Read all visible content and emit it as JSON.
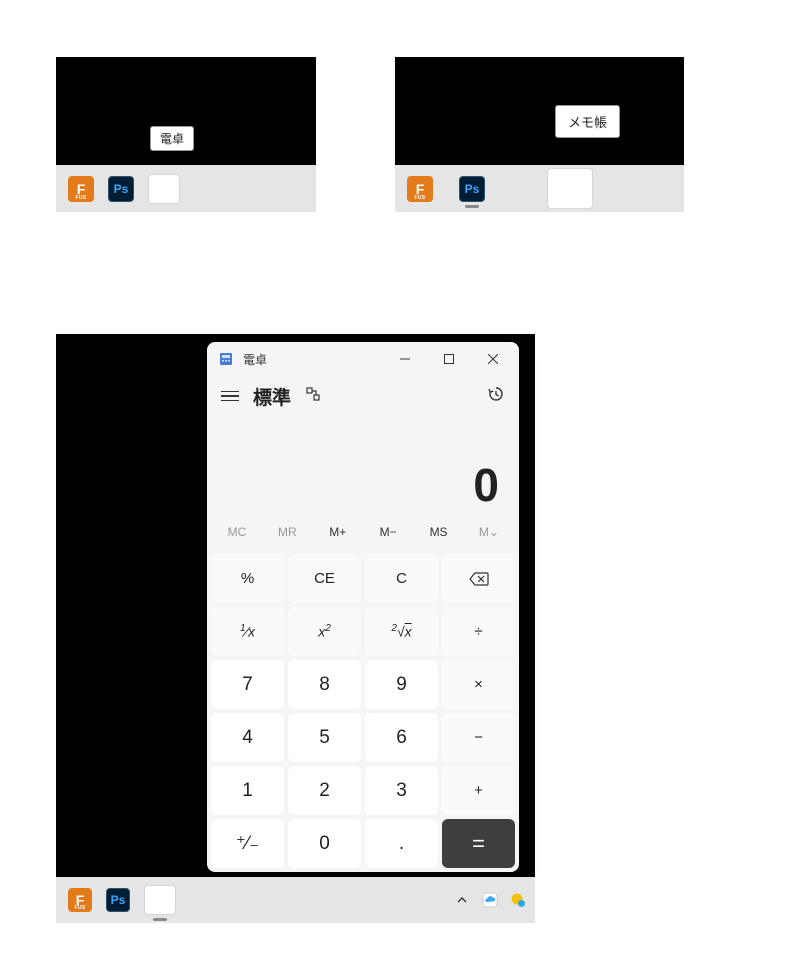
{
  "thumb1": {
    "tooltip": "電卓",
    "taskbar": {
      "fusion_label": "F",
      "fusion_sub": "FUS",
      "ps_label": "Ps"
    }
  },
  "thumb2": {
    "tooltip": "メモ帳",
    "taskbar": {
      "fusion_label": "F",
      "fusion_sub": "FUS",
      "ps_label": "Ps"
    }
  },
  "panel3": {
    "taskbar": {
      "fusion_label": "F",
      "fusion_sub": "FUS",
      "ps_label": "Ps"
    }
  },
  "calc": {
    "title": "電卓",
    "mode": "標準",
    "display_value": "0",
    "memory": {
      "mc": "MC",
      "mr": "MR",
      "mplus": "M+",
      "mminus": "M−",
      "ms": "MS",
      "mdrop": "M⌄"
    },
    "keys": {
      "percent": "%",
      "ce": "CE",
      "c": "C",
      "back": "⌫",
      "recip": "¹⁄ₓ",
      "sqr": "x²",
      "sqrt": "²√x",
      "div": "÷",
      "k7": "7",
      "k8": "8",
      "k9": "9",
      "mul": "×",
      "k4": "4",
      "k5": "5",
      "k6": "6",
      "sub": "−",
      "k1": "1",
      "k2": "2",
      "k3": "3",
      "add": "+",
      "neg": "⁺⁄₋",
      "k0": "0",
      "dot": ".",
      "eq": "="
    }
  }
}
